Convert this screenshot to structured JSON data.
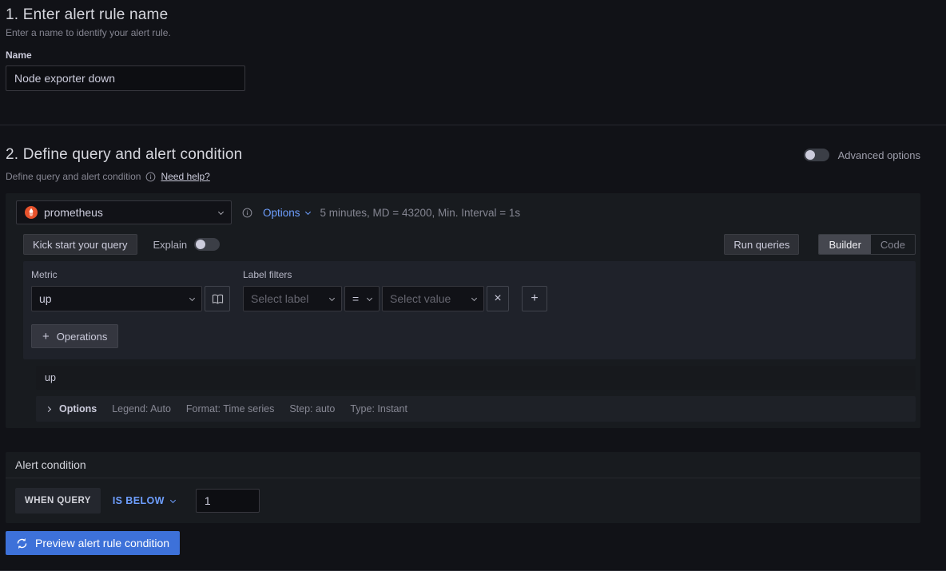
{
  "section_name": {
    "title": "1. Enter alert rule name",
    "subtitle": "Enter a name to identify your alert rule.",
    "field_label": "Name",
    "field_value": "Node exporter down"
  },
  "section_query": {
    "title": "2. Define query and alert condition",
    "advanced_options_label": "Advanced options",
    "subtitle": "Define query and alert condition",
    "need_help": "Need help?",
    "datasource": {
      "name": "prometheus",
      "options_label": "Options",
      "options_summary": "5 minutes, MD = 43200, Min. Interval = 1s"
    },
    "toolbar": {
      "kick_start": "Kick start your query",
      "explain": "Explain",
      "run_queries": "Run queries",
      "mode_builder": "Builder",
      "mode_code": "Code"
    },
    "builder": {
      "metric_label": "Metric",
      "metric_value": "up",
      "label_filters_label": "Label filters",
      "select_label_placeholder": "Select label",
      "operator": "=",
      "select_value_placeholder": "Select value",
      "operations_label": "Operations"
    },
    "preview_expression": "up",
    "options_row": {
      "toggle_label": "Options",
      "legend": "Legend: Auto",
      "format": "Format: Time series",
      "step": "Step: auto",
      "type": "Type: Instant"
    },
    "alert_condition": {
      "title": "Alert condition",
      "when_query": "WHEN QUERY",
      "condition": "IS BELOW",
      "threshold": "1"
    },
    "preview_button": "Preview alert rule condition"
  },
  "icons": {
    "remove_filter": "×",
    "add_filter": "+",
    "operations_plus": "+"
  },
  "colors": {
    "accent_blue": "#3d71d9",
    "link_blue": "#6e9fff",
    "prometheus_orange": "#e6522c",
    "page_bg": "#111217",
    "panel_bg": "#181b1f"
  }
}
